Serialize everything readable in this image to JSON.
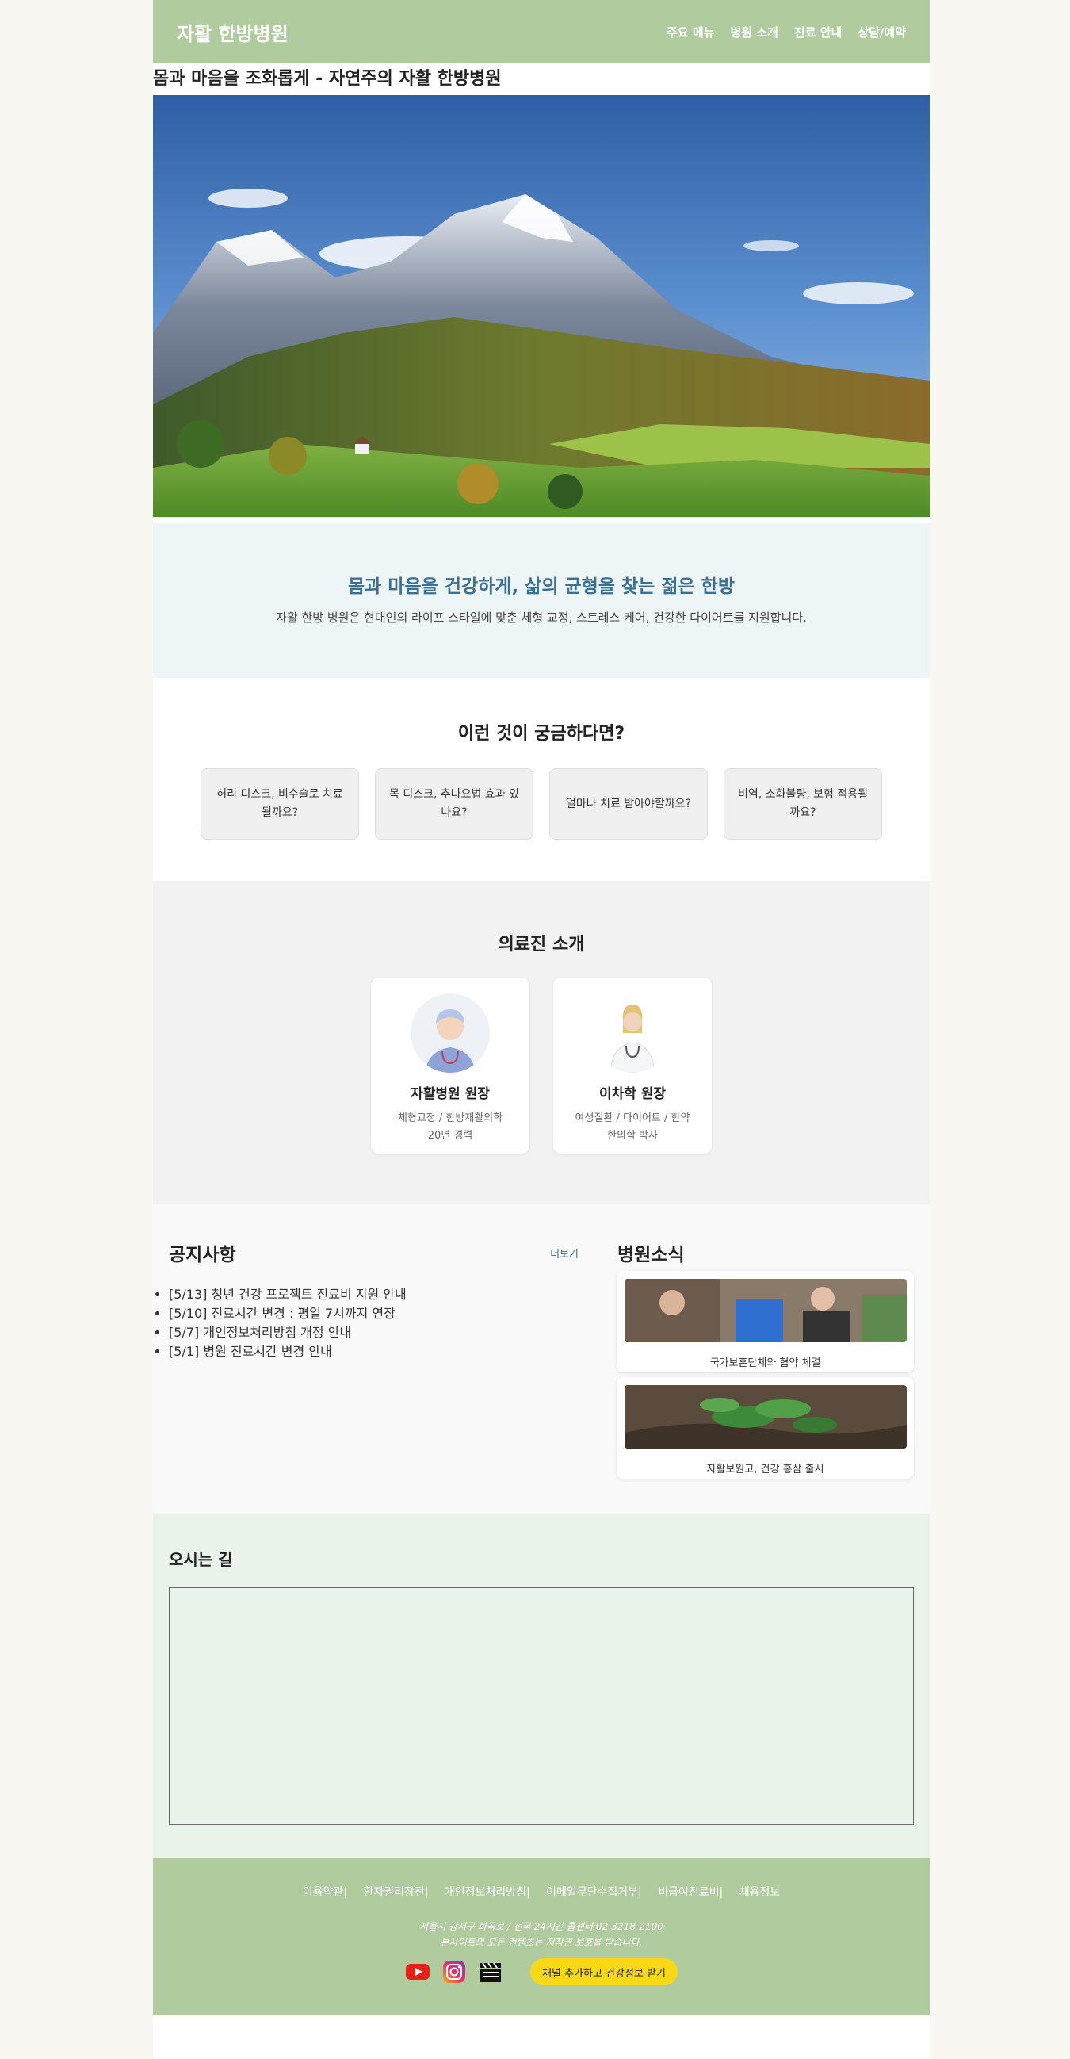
{
  "header": {
    "logo": "자활 한방병원",
    "nav": [
      "주요 메뉴",
      "병원 소개",
      "진료 안내",
      "상담/예약"
    ]
  },
  "subtitle": "몸과 마음을 조화롭게 - 자연주의 자활 한방병원",
  "intro": {
    "title": "몸과 마음을 건강하게, 삶의 균형을 찾는 젊은 한방",
    "text": "자활 한방 병원은 현대인의 라이프 스타일에 맞춘 체형 교정, 스트레스 케어, 건강한 다이어트를 지원합니다."
  },
  "faq": {
    "title": "이런 것이 궁금하다면?",
    "items": [
      "허리 디스크, 비수술로 치료될까요?",
      "목 디스크, 추나요법 효과 있나요?",
      "얼마나 치료 받아야할까요?",
      "비염, 소화불량, 보험 적용될까요?"
    ]
  },
  "doctors": {
    "title": "의료진 소개",
    "items": [
      {
        "name": "자활병원 원장",
        "desc1": "체형교정 / 한방재활의학",
        "desc2": "20년 경력"
      },
      {
        "name": "이차학 원장",
        "desc1": "여성질환 / 다이어트 / 한약",
        "desc2": "한의학 박사"
      }
    ]
  },
  "notice": {
    "title": "공지사항",
    "more": "더보기",
    "items": [
      "[5/13] 청년 건강 프로젝트 진료비 지원 안내",
      "[5/10] 진료시간 변경 : 평일 7시까지 연장",
      "[5/7] 개인정보처리방침 개정 안내",
      "[5/1] 병원 진료시간 변경 안내"
    ]
  },
  "hospital_news": {
    "title": "병원소식",
    "items": [
      {
        "caption": "국가보훈단체와 협약 체결"
      },
      {
        "caption": "자활보원고, 건강 홍삼 출시"
      }
    ]
  },
  "directions": {
    "title": "오시는 길"
  },
  "footer": {
    "links": [
      "이용약관|",
      "환자권리장전|",
      "개인정보처리방침|",
      "이메일무단수집거부|",
      "비급여진료비|",
      "채용정보"
    ],
    "info1": "서울시 강서구 화곡로 / 전국 24시간 콜센터:02-3218-2100",
    "info2": "본사이트의 모든 컨텐츠는 저작권 보호를 받습니다.",
    "kakao_button": "채널 추가하고 건강정보 받기",
    "icons": [
      "youtube-icon",
      "instagram-icon",
      "clapperboard-icon"
    ]
  },
  "colors": {
    "header_bg": "#b0cb9e",
    "intro_bg": "#edf5f6",
    "accent_blue": "#3c7092",
    "kakao_yellow": "#f9d816"
  }
}
